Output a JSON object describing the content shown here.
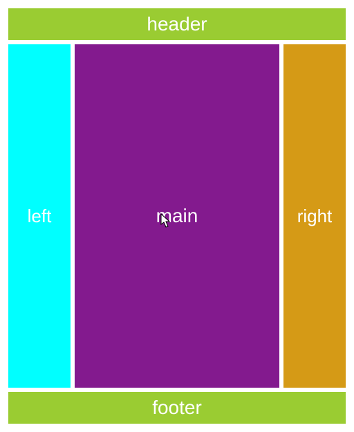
{
  "layout": {
    "header": "header",
    "left": "left",
    "main": "main",
    "right": "right",
    "footer": "footer"
  },
  "colors": {
    "header_bg": "#9acc32",
    "left_bg": "#00ffff",
    "main_bg": "#831a8e",
    "right_bg": "#d59a16",
    "footer_bg": "#9acc32",
    "text": "#ffffff"
  }
}
